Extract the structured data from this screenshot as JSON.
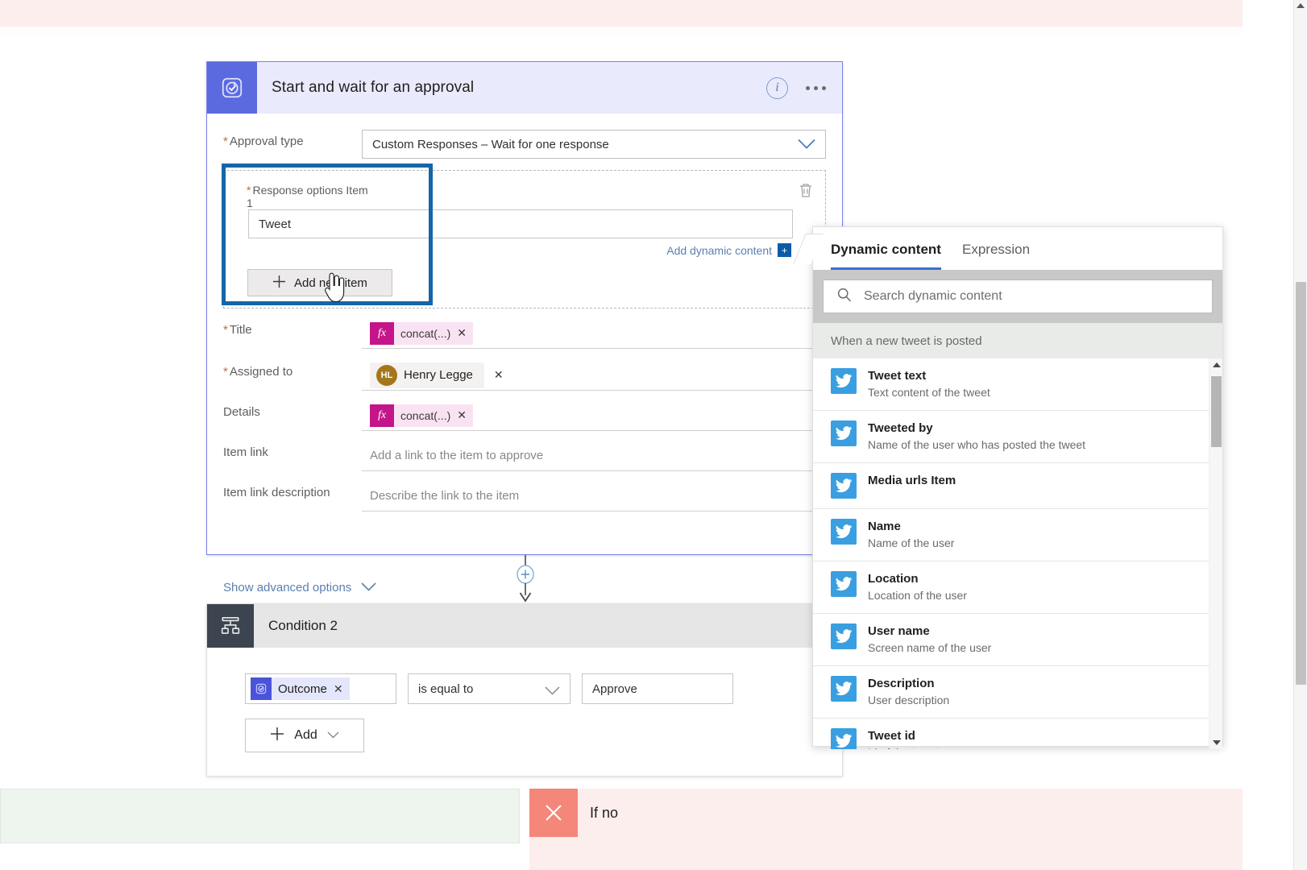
{
  "approval_card": {
    "icon_name": "approvals-icon",
    "title": "Start and wait for an approval",
    "info_icon": "info-icon",
    "more_icon": "ellipsis-icon",
    "approval_type": {
      "label": "Approval type",
      "required": "*",
      "value": "Custom Responses – Wait for one response",
      "chevron_icon": "chevron-down-icon"
    },
    "response_options": {
      "label": "Response options Item",
      "index": "1",
      "required": "*",
      "value": "Tweet",
      "add_dynamic_content": "Add dynamic content",
      "add_dynamic_badge": "+",
      "add_new_item": "Add new item",
      "add_icon": "plus-icon",
      "delete_icon": "trash-icon"
    },
    "title_field": {
      "label": "Title",
      "required": "*",
      "token": "concat(...)",
      "token_icon": "fx-icon",
      "remove_icon": "close-icon"
    },
    "assigned_to": {
      "label": "Assigned to",
      "required": "*",
      "person_initials": "HL",
      "person_name": "Henry Legge",
      "remove_icon": "close-icon"
    },
    "details": {
      "label": "Details",
      "token": "concat(...)",
      "token_icon": "fx-icon",
      "remove_icon": "close-icon"
    },
    "item_link": {
      "label": "Item link",
      "placeholder": "Add a link to the item to approve"
    },
    "item_link_description": {
      "label": "Item link description",
      "placeholder": "Describe the link to the item"
    },
    "show_advanced": {
      "label": "Show advanced options",
      "chevron_icon": "chevron-down-icon"
    }
  },
  "connector": {
    "add_step_icon": "plus-circle-icon",
    "arrow_icon": "arrow-down-icon"
  },
  "condition_card": {
    "icon_name": "condition-icon",
    "title": "Condition 2",
    "more_icon": "ellipsis-icon",
    "row": {
      "token_label": "Outcome",
      "token_icon": "approvals-icon",
      "token_remove_icon": "close-icon",
      "operator": "is equal to",
      "operator_chevron_icon": "chevron-down-icon",
      "value": "Approve"
    },
    "add_button": {
      "label": "Add",
      "plus_icon": "plus-icon",
      "chevron_icon": "chevron-down-icon"
    }
  },
  "branches": {
    "if_no_label": "If no",
    "if_no_icon": "x-icon"
  },
  "dynamic_panel": {
    "tabs": [
      {
        "label": "Dynamic content",
        "active": true
      },
      {
        "label": "Expression",
        "active": false
      }
    ],
    "search": {
      "placeholder": "Search dynamic content",
      "icon": "search-icon"
    },
    "group_title": "When a new tweet is posted",
    "items": [
      {
        "title": "Tweet text",
        "sub": "Text content of the tweet",
        "icon": "twitter-icon"
      },
      {
        "title": "Tweeted by",
        "sub": "Name of the user who has posted the tweet",
        "icon": "twitter-icon"
      },
      {
        "title": "Media urls Item",
        "sub": "",
        "icon": "twitter-icon"
      },
      {
        "title": "Name",
        "sub": "Name of the user",
        "icon": "twitter-icon"
      },
      {
        "title": "Location",
        "sub": "Location of the user",
        "icon": "twitter-icon"
      },
      {
        "title": "User name",
        "sub": "Screen name of the user",
        "icon": "twitter-icon"
      },
      {
        "title": "Description",
        "sub": "User description",
        "icon": "twitter-icon"
      },
      {
        "title": "Tweet id",
        "sub": "Id of the tweet",
        "icon": "twitter-icon"
      }
    ],
    "scrollbar": {
      "up_icon": "scroll-up-icon",
      "down_icon": "scroll-down-icon"
    }
  },
  "browser_scrollbar": {
    "up_icon": "scroll-up-icon"
  },
  "colors": {
    "approval_accent": "#5c6ae0",
    "approval_header_bg": "#e9eafc",
    "highlight_border": "#1565a8",
    "twitter_blue": "#3a9fe0",
    "fx_magenta": "#c4158a",
    "avatar_gold": "#a4771a",
    "if_no_red": "#f4867a",
    "if_yes_green": "#eef5ef"
  }
}
